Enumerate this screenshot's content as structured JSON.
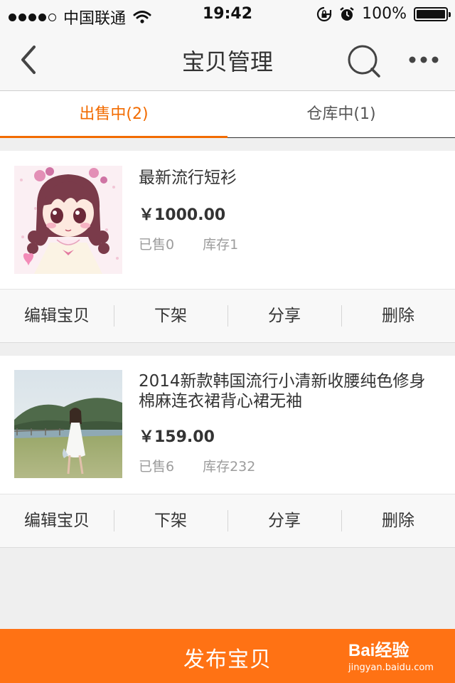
{
  "status_bar": {
    "carrier": "中国联通",
    "time": "19:42",
    "battery_percent": "100%",
    "battery_level": 1.0,
    "signal_bars": 4
  },
  "nav": {
    "title": "宝贝管理",
    "back_icon": "back-arrow-icon",
    "search_icon": "search-icon",
    "more_icon": "more-dots-icon"
  },
  "tabs": [
    {
      "label": "出售中(2)",
      "active": true
    },
    {
      "label": "仓库中(1)",
      "active": false
    }
  ],
  "items": [
    {
      "title": "最新流行短衫",
      "price": "￥1000.00",
      "sold": "已售0",
      "stock": "库存1",
      "image": "anime-girl-illustration"
    },
    {
      "title": "2014新款韩国流行小清新收腰纯色修身棉麻连衣裙背心裙无袖",
      "price": "￥159.00",
      "sold": "已售6",
      "stock": "库存232",
      "image": "woman-in-white-dress-photo"
    }
  ],
  "actions": {
    "edit": "编辑宝贝",
    "delist": "下架",
    "share": "分享",
    "delete": "删除"
  },
  "publish_button": "发布宝贝",
  "watermark": {
    "logo": "Bai经验",
    "url": "jingyan.baidu.com"
  },
  "colors": {
    "accent": "#f26b00",
    "publish_bg": "#ff7214"
  }
}
